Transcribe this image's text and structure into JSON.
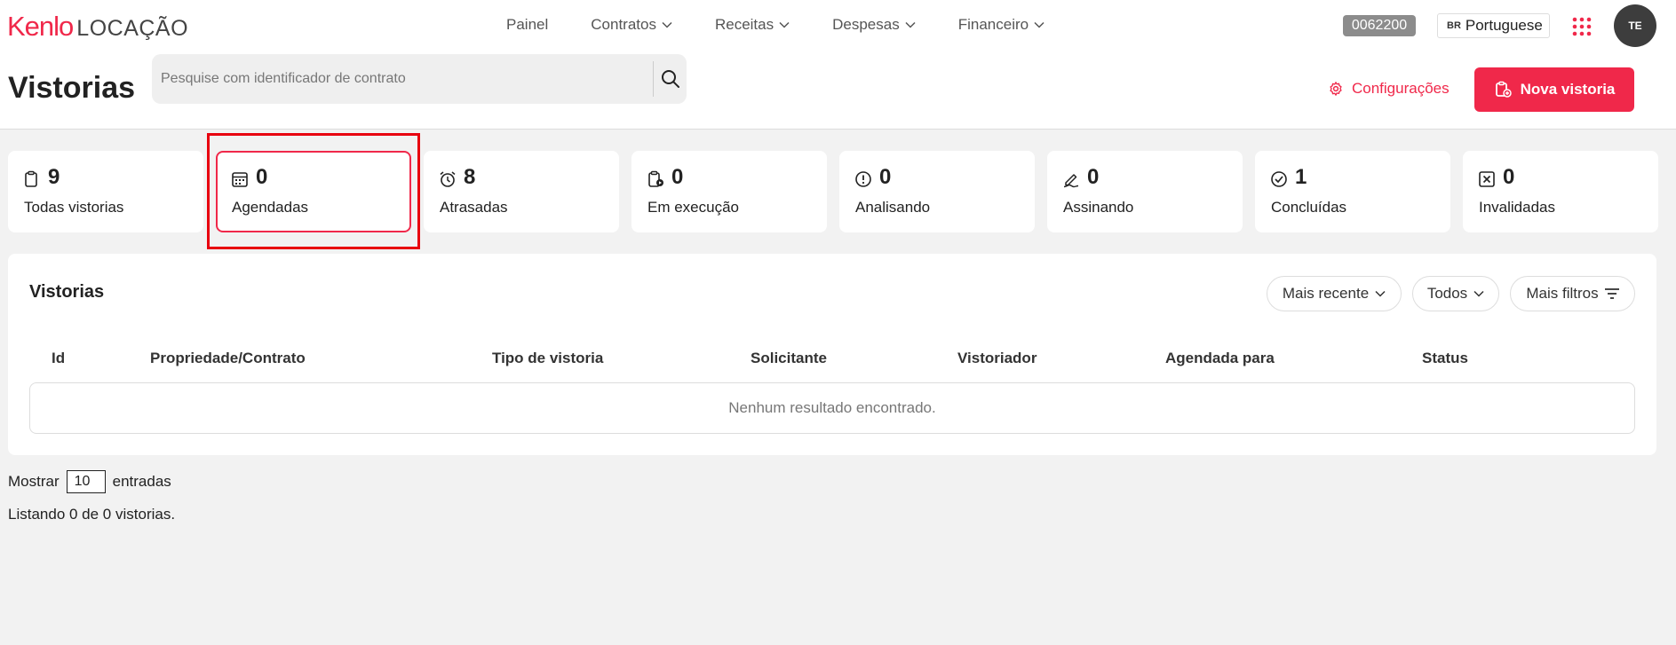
{
  "header": {
    "logo_brand": "Kenlo",
    "logo_sub": "LOCAÇÃO",
    "nav": [
      {
        "label": "Painel",
        "dropdown": false
      },
      {
        "label": "Contratos",
        "dropdown": true
      },
      {
        "label": "Receitas",
        "dropdown": true
      },
      {
        "label": "Despesas",
        "dropdown": true
      },
      {
        "label": "Financeiro",
        "dropdown": true
      }
    ],
    "account_code": "0062200",
    "language_flag": "BR",
    "language": "Portuguese",
    "avatar_initials": "TE"
  },
  "page": {
    "title": "Vistorias",
    "search_placeholder": "Pesquise com identificador de contrato",
    "config_label": "Configurações",
    "new_button_label": "Nova vistoria"
  },
  "stats": [
    {
      "count": "9",
      "label": "Todas vistorias",
      "icon": "clipboard-icon"
    },
    {
      "count": "0",
      "label": "Agendadas",
      "icon": "calendar-icon",
      "active": true
    },
    {
      "count": "8",
      "label": "Atrasadas",
      "icon": "alarm-clock-icon"
    },
    {
      "count": "0",
      "label": "Em execução",
      "icon": "clipboard-play-icon"
    },
    {
      "count": "0",
      "label": "Analisando",
      "icon": "alert-circle-icon"
    },
    {
      "count": "0",
      "label": "Assinando",
      "icon": "signature-pen-icon"
    },
    {
      "count": "1",
      "label": "Concluídas",
      "icon": "check-circle-icon"
    },
    {
      "count": "0",
      "label": "Invalidadas",
      "icon": "x-square-icon"
    }
  ],
  "list": {
    "title": "Vistorias",
    "filters": {
      "sort": "Mais recente",
      "status": "Todos",
      "more": "Mais filtros"
    },
    "columns": [
      "Id",
      "Propriedade/Contrato",
      "Tipo de vistoria",
      "Solicitante",
      "Vistoriador",
      "Agendada para",
      "Status"
    ],
    "empty_message": "Nenhum resultado encontrado."
  },
  "footer": {
    "show_label": "Mostrar",
    "page_size": "10",
    "entries_label": "entradas",
    "listing": "Listando 0 de 0 vistorias."
  },
  "colors": {
    "accent": "#f0284a",
    "highlight": "#e8000f"
  }
}
